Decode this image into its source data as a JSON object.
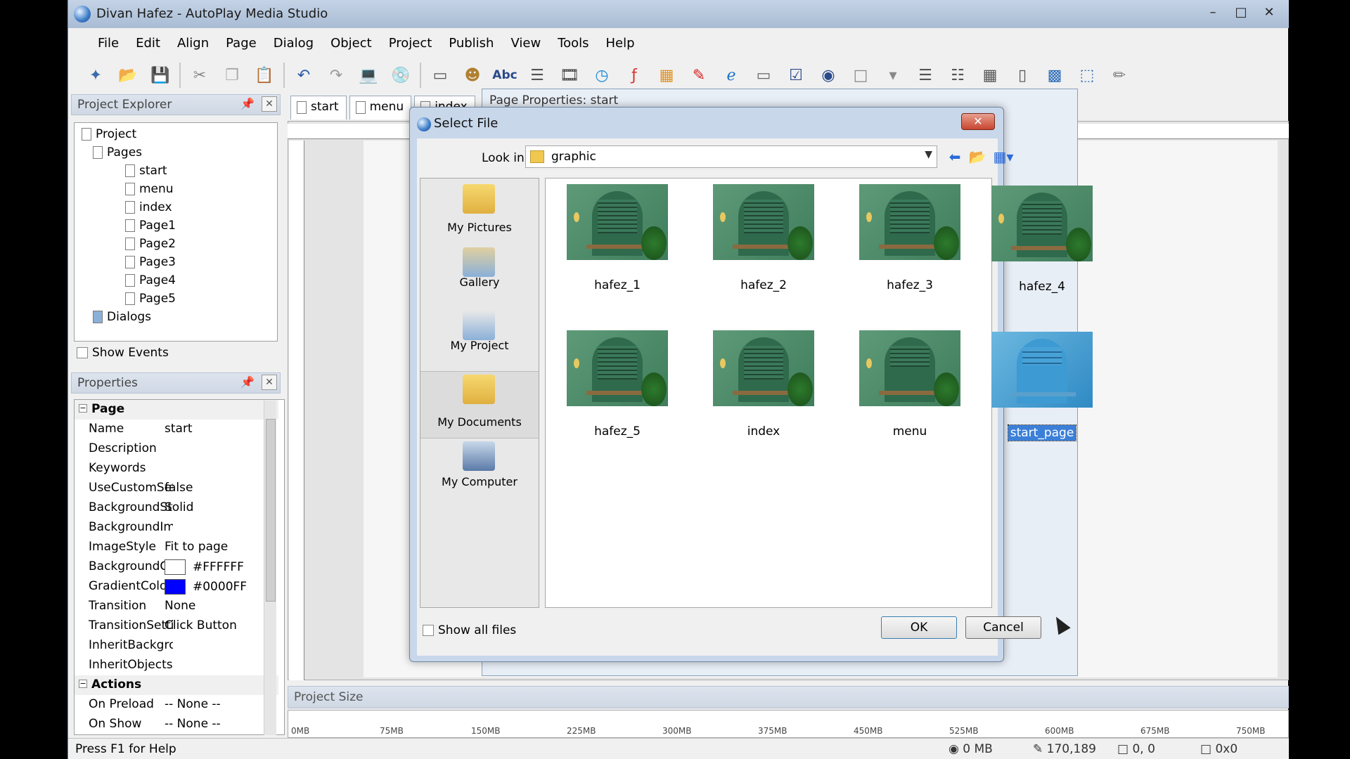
{
  "window": {
    "title": "Divan Hafez - AutoPlay Media Studio"
  },
  "menu": [
    "File",
    "Edit",
    "Align",
    "Page",
    "Dialog",
    "Object",
    "Project",
    "Publish",
    "View",
    "Tools",
    "Help"
  ],
  "project_explorer": {
    "title": "Project Explorer",
    "root": "Project",
    "pages_label": "Pages",
    "pages": [
      "start",
      "menu",
      "index",
      "Page1",
      "Page2",
      "Page3",
      "Page4",
      "Page5"
    ],
    "dialogs_label": "Dialogs",
    "show_events": "Show Events"
  },
  "properties": {
    "title": "Properties",
    "category_page": "Page",
    "rows": [
      {
        "k": "Name",
        "v": "start"
      },
      {
        "k": "Description",
        "v": ""
      },
      {
        "k": "Keywords",
        "v": ""
      },
      {
        "k": "UseCustomSett",
        "v": "false"
      },
      {
        "k": "BackgroundStyl",
        "v": "Solid"
      },
      {
        "k": "BackgroundIma",
        "v": ""
      },
      {
        "k": "ImageStyle",
        "v": "Fit to page"
      },
      {
        "k": "BackgroundCol",
        "v": "#FFFFFF",
        "color": "#FFFFFF"
      },
      {
        "k": "GradientColor",
        "v": "#0000FF",
        "color": "#0000FF"
      },
      {
        "k": "Transition",
        "v": "None"
      },
      {
        "k": "TransitionSettin",
        "v": "Click Button"
      },
      {
        "k": "InheritBackgrou",
        "v": ""
      },
      {
        "k": "InheritObjects",
        "v": ""
      }
    ],
    "category_actions": "Actions",
    "action_rows": [
      {
        "k": "On Preload",
        "v": "-- None --"
      },
      {
        "k": "On Show",
        "v": "-- None --"
      }
    ]
  },
  "tabs": [
    "start",
    "menu",
    "index"
  ],
  "page_properties_title": "Page Properties: start",
  "project_size": {
    "title": "Project Size",
    "ticks": [
      "0MB",
      "75MB",
      "150MB",
      "225MB",
      "300MB",
      "375MB",
      "450MB",
      "525MB",
      "600MB",
      "675MB",
      "750MB"
    ]
  },
  "status": {
    "help": "Press F1 for Help",
    "size": "0 MB",
    "coords": "170,189",
    "pos": "0, 0",
    "dim": "0x0"
  },
  "select_file": {
    "title": "Select File",
    "look_in_label": "Look in:",
    "look_in_value": "graphic",
    "places": [
      "My Pictures",
      "Gallery",
      "My Project",
      "My Documents",
      "My Computer"
    ],
    "files": [
      {
        "name": "hafez_1",
        "style": "green"
      },
      {
        "name": "hafez_2",
        "style": "green"
      },
      {
        "name": "hafez_3",
        "style": "green"
      },
      {
        "name": "hafez_4",
        "style": "green"
      },
      {
        "name": "hafez_5",
        "style": "green"
      },
      {
        "name": "index",
        "style": "green"
      },
      {
        "name": "menu",
        "style": "green"
      },
      {
        "name": "start_page",
        "style": "blue",
        "selected": true
      }
    ],
    "show_all_files": "Show all files",
    "ok": "OK",
    "cancel": "Cancel"
  }
}
